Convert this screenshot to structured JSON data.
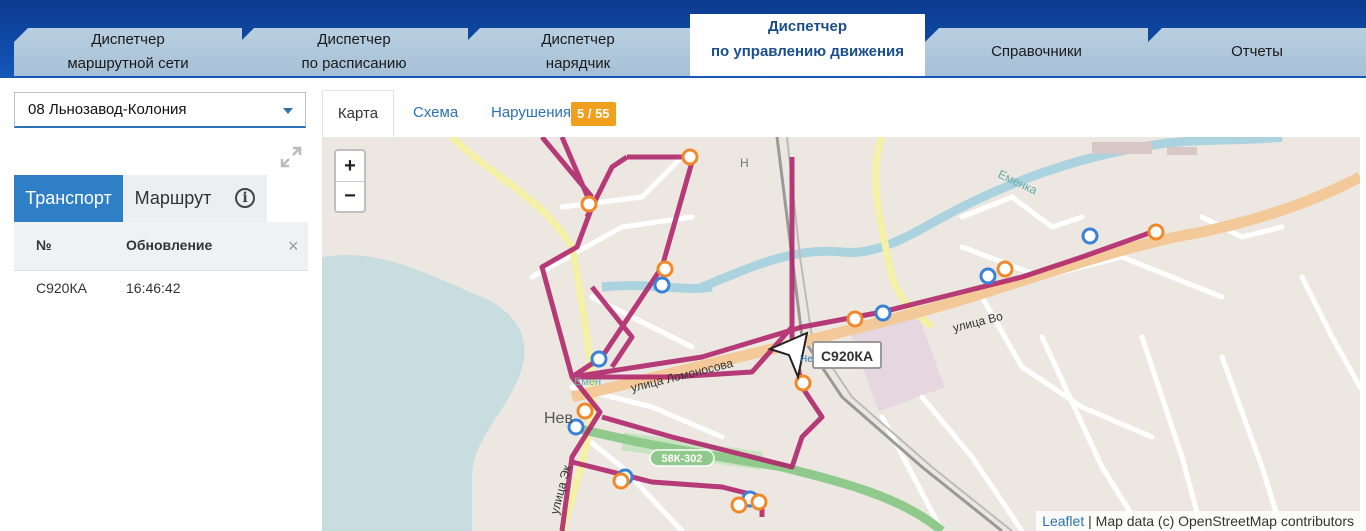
{
  "nav": {
    "tabs": [
      {
        "line1": "Диспетчер",
        "line2": "маршрутной сети"
      },
      {
        "line1": "Диспетчер",
        "line2": "по расписанию"
      },
      {
        "line1": "Диспетчер",
        "line2": "нарядчик"
      },
      {
        "line1": "Диспетчер",
        "line2": "по управлению движения"
      },
      {
        "line1": "Справочники"
      },
      {
        "line1": "Отчеты"
      }
    ],
    "active_index": 3
  },
  "left": {
    "route_select": {
      "value": "08 Льнозавод-Колония"
    },
    "tabs": {
      "transport": "Транспорт",
      "route": "Маршрут"
    },
    "table": {
      "headers": {
        "num": "№",
        "update": "Обновление"
      },
      "rows": [
        {
          "num": "С920КА",
          "update": "16:46:42"
        }
      ]
    }
  },
  "right": {
    "tabs": {
      "map": "Карта",
      "schema": "Схема",
      "violations": "Нарушения"
    },
    "violations_badge": "5 / 55"
  },
  "map": {
    "vehicle_label": "С920КА",
    "zoom_in": "+",
    "zoom_out": "−",
    "attribution_link": "Leaflet",
    "attribution_text": " | Map data (c) OpenStreetMap contributors",
    "labels": {
      "street_lomonosova": "улица Ломоносова",
      "street_vo": "улица Во",
      "street_ek": "улица Эк",
      "river": "Еменка",
      "river2": "Емен",
      "town": "Нев",
      "road_code": "58К-302",
      "ne": "Не",
      "h": "Н"
    },
    "colors": {
      "route": "#b0286c",
      "stop_orange": "#f0892a",
      "stop_blue": "#3b82d6",
      "highway": "#ecd8a0"
    }
  }
}
